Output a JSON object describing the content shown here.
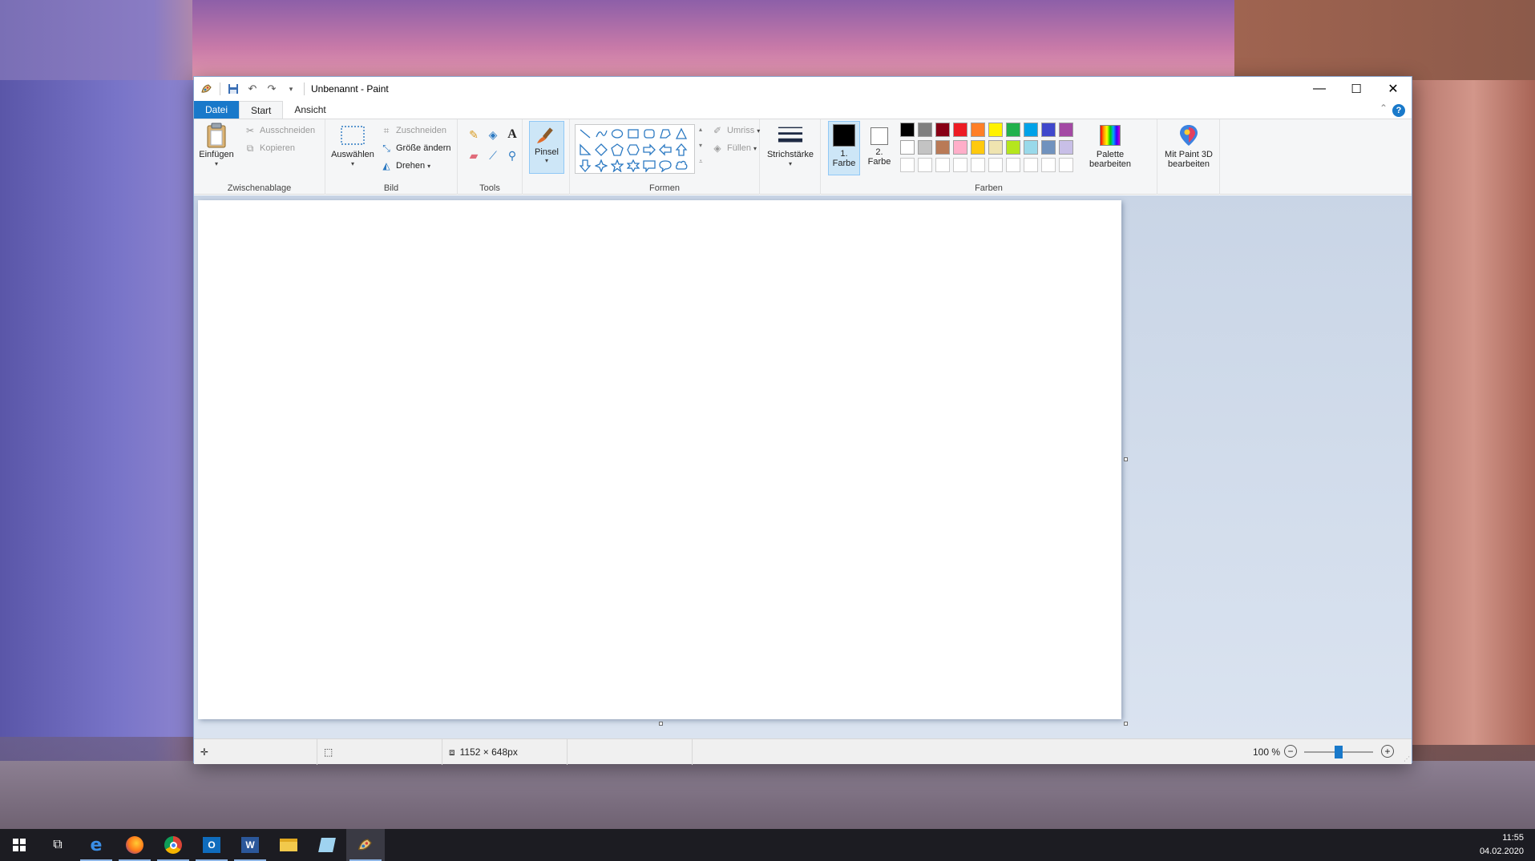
{
  "window": {
    "title": "Unbenannt - Paint",
    "controls": {
      "minimize": "—",
      "maximize": "☐",
      "close": "✕"
    }
  },
  "ribbon_tabs": [
    {
      "label": "Datei"
    },
    {
      "label": "Start"
    },
    {
      "label": "Ansicht"
    }
  ],
  "clipboard": {
    "paste": "Einfügen",
    "cut": "Ausschneiden",
    "copy": "Kopieren",
    "group": "Zwischenablage"
  },
  "image": {
    "select": "Auswählen",
    "crop": "Zuschneiden",
    "resize": "Größe ändern",
    "rotate": "Drehen",
    "group": "Bild"
  },
  "tools": {
    "group": "Tools"
  },
  "brushes": {
    "label": "Pinsel"
  },
  "shapes": {
    "outline": "Umriss",
    "fill": "Füllen",
    "group": "Formen"
  },
  "stroke": {
    "label": "Strichstärke"
  },
  "colors": {
    "color1_line1": "1.",
    "color1_line2": "Farbe",
    "color2_line1": "2.",
    "color2_line2": "Farbe",
    "edit_palette_line1": "Palette",
    "edit_palette_line2": "bearbeiten",
    "group": "Farben",
    "color1": "#000000",
    "color2": "#ffffff",
    "palette_row1": [
      "#000000",
      "#7f7f7f",
      "#880015",
      "#ed1c24",
      "#ff7f27",
      "#fff200",
      "#22b14c",
      "#00a2e8",
      "#3f48cc",
      "#a349a4"
    ],
    "palette_row2": [
      "#ffffff",
      "#c3c3c3",
      "#b97a57",
      "#ffaec9",
      "#ffc90e",
      "#efe4b0",
      "#b5e61d",
      "#99d9ea",
      "#7092be",
      "#c8bfe7"
    ]
  },
  "paint3d": {
    "line1": "Mit Paint 3D",
    "line2": "bearbeiten"
  },
  "status": {
    "canvas_size": "1152 × 648px",
    "zoom": "100 %",
    "zoom_fraction": 0.5
  },
  "taskbar": {
    "time": "11:55",
    "date": "04.02.2020"
  }
}
